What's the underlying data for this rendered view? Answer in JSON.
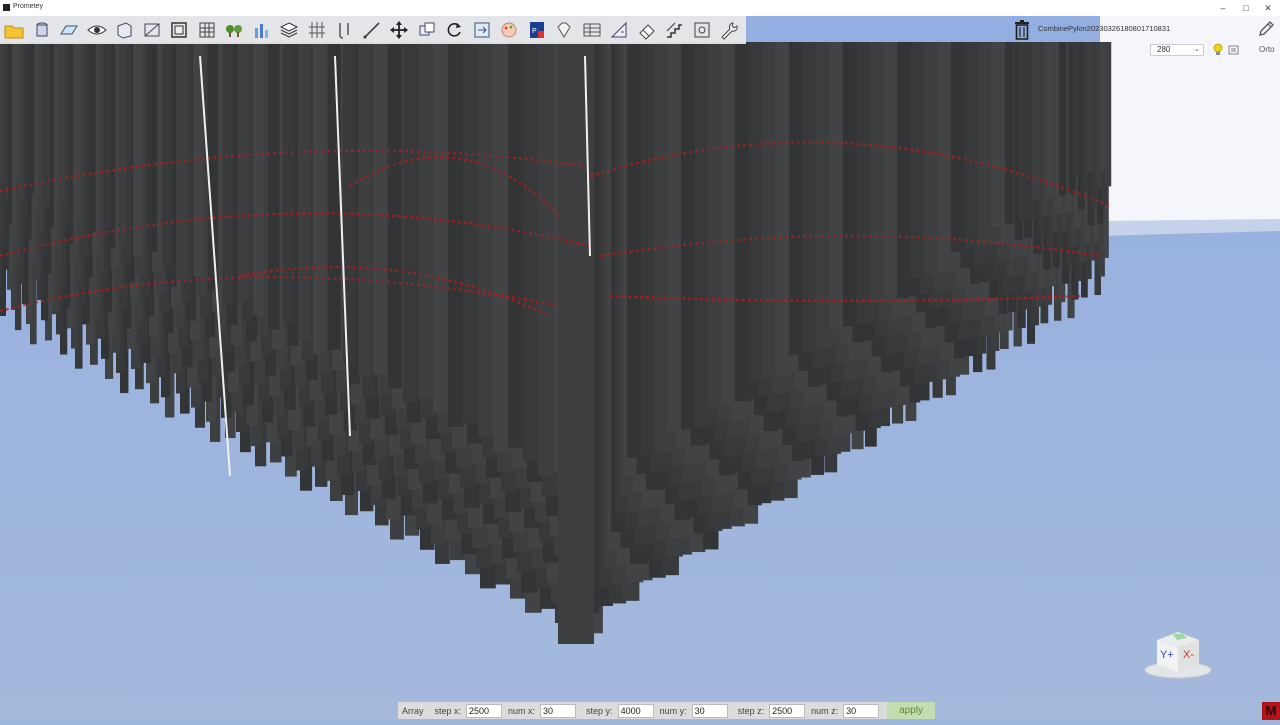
{
  "window": {
    "title": "Prometey",
    "minimize": "–",
    "maximize": "□",
    "close": "✕"
  },
  "toolbar": {
    "tools": [
      "open-folder-icon",
      "cylinder-icon",
      "plane-icon",
      "eye-icon",
      "box-icon",
      "section-icon",
      "frame-icon",
      "grid-icon",
      "trees-icon",
      "bars-icon",
      "layers-icon",
      "column-grid-icon",
      "pile-icon",
      "line-icon",
      "move-icon",
      "copy-icon",
      "rotate-icon",
      "export-icon",
      "palette-icon",
      "pdf-icon",
      "gem-icon",
      "table-icon",
      "measure-icon",
      "eraser-icon",
      "stairs-icon",
      "snapshot-icon",
      "wrench-icon"
    ]
  },
  "document": {
    "name": "CombinePylon20230326180801710831"
  },
  "view": {
    "zoom": "280",
    "projection_label": "Orto",
    "navcube": {
      "left": "Y+",
      "right": "X-"
    }
  },
  "array_panel": {
    "title": "Array",
    "step_x_label": "step x:",
    "step_x": "2500",
    "num_x_label": "num x:",
    "num_x": "30",
    "step_y_label": "step y:",
    "step_y": "4000",
    "num_y_label": "num y:",
    "num_y": "30",
    "step_z_label": "step z:",
    "step_z": "2500",
    "num_z_label": "num z:",
    "num_z": "30",
    "apply_label": "apply"
  },
  "badge": "M",
  "colors": {
    "sky": "#f4f6fb",
    "ground": "#9fb6dd",
    "pylon": "#3b3d3f",
    "rebar": "#b01e1e",
    "apply_bg": "#c3ddb0"
  }
}
